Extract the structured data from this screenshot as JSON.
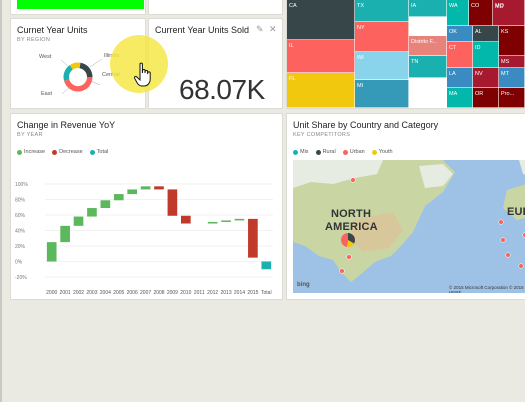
{
  "tiles": {
    "current_year_units": {
      "title": "Curnet Year Units",
      "subtitle": "BY REGION",
      "segment_labels": {
        "west": "West",
        "east": "East",
        "central": "Central",
        "illinois": "Illinois"
      }
    },
    "units_sold": {
      "title": "Current Year Units Sold",
      "value": "68.07K"
    },
    "revenue_yoy": {
      "title": "Change in Revenue YoY",
      "subtitle": "BY YEAR",
      "legend": [
        "Increase",
        "Decrease",
        "Total"
      ]
    },
    "unit_share": {
      "title": "Unit Share by Country and Category",
      "subtitle": "KEY COMPETITORS",
      "legend": [
        "Mix",
        "Rural",
        "Urban",
        "Youth"
      ],
      "map_labels": {
        "north": "NORTH",
        "america": "AMERICA",
        "europe": "EUR"
      },
      "bing_logo": "bing",
      "copyright": "© 2015 Microsoft Corporation  © 2015 HERE"
    },
    "treemap": {
      "labels": [
        "CA",
        "TX",
        "IA",
        "WA",
        "CO",
        "MO",
        "MD",
        "NY",
        "GA",
        "IL",
        "Distrito F...",
        "OK",
        "AL",
        "KS",
        "WI",
        "CT",
        "ID",
        "TN",
        "LA",
        "MS",
        "FL",
        "NV",
        "MT",
        "MI",
        "MA",
        "OR",
        "Pro..."
      ]
    }
  },
  "colors": {
    "increase": "#5cb85c",
    "decrease": "#c0392b",
    "total": "#1ab0b0",
    "mix": "#1ab0b0",
    "rural": "#374649",
    "urban": "#fd625e",
    "youth": "#f2c80f",
    "highlight": "#f5e742"
  },
  "chart_data": {
    "type": "bar",
    "title": "Change in Revenue YoY",
    "subtitle": "BY YEAR",
    "categories": [
      "2000",
      "2001",
      "2002",
      "2003",
      "2004",
      "2005",
      "2006",
      "2007",
      "2008",
      "2009",
      "2010",
      "2011",
      "2012",
      "2013",
      "2014",
      "2015",
      "Total"
    ],
    "series": [
      {
        "name": "Increase",
        "values": [
          25,
          21,
          12,
          11,
          10,
          8,
          6,
          4,
          0,
          0,
          0,
          0,
          2,
          2,
          2,
          0,
          0
        ]
      },
      {
        "name": "Decrease",
        "values": [
          0,
          0,
          0,
          0,
          0,
          0,
          0,
          0,
          -4,
          -34,
          -10,
          0,
          0,
          0,
          0,
          -50,
          0
        ]
      },
      {
        "name": "Total",
        "values": [
          0,
          0,
          0,
          0,
          0,
          0,
          0,
          0,
          0,
          0,
          0,
          0,
          0,
          0,
          0,
          0,
          -10
        ]
      }
    ],
    "ytick_labels": [
      "100%",
      "80%",
      "60%",
      "40%",
      "20%",
      "0%",
      "-20%"
    ],
    "ylim": [
      -20,
      100
    ],
    "grid": true,
    "legend": "top-left"
  }
}
